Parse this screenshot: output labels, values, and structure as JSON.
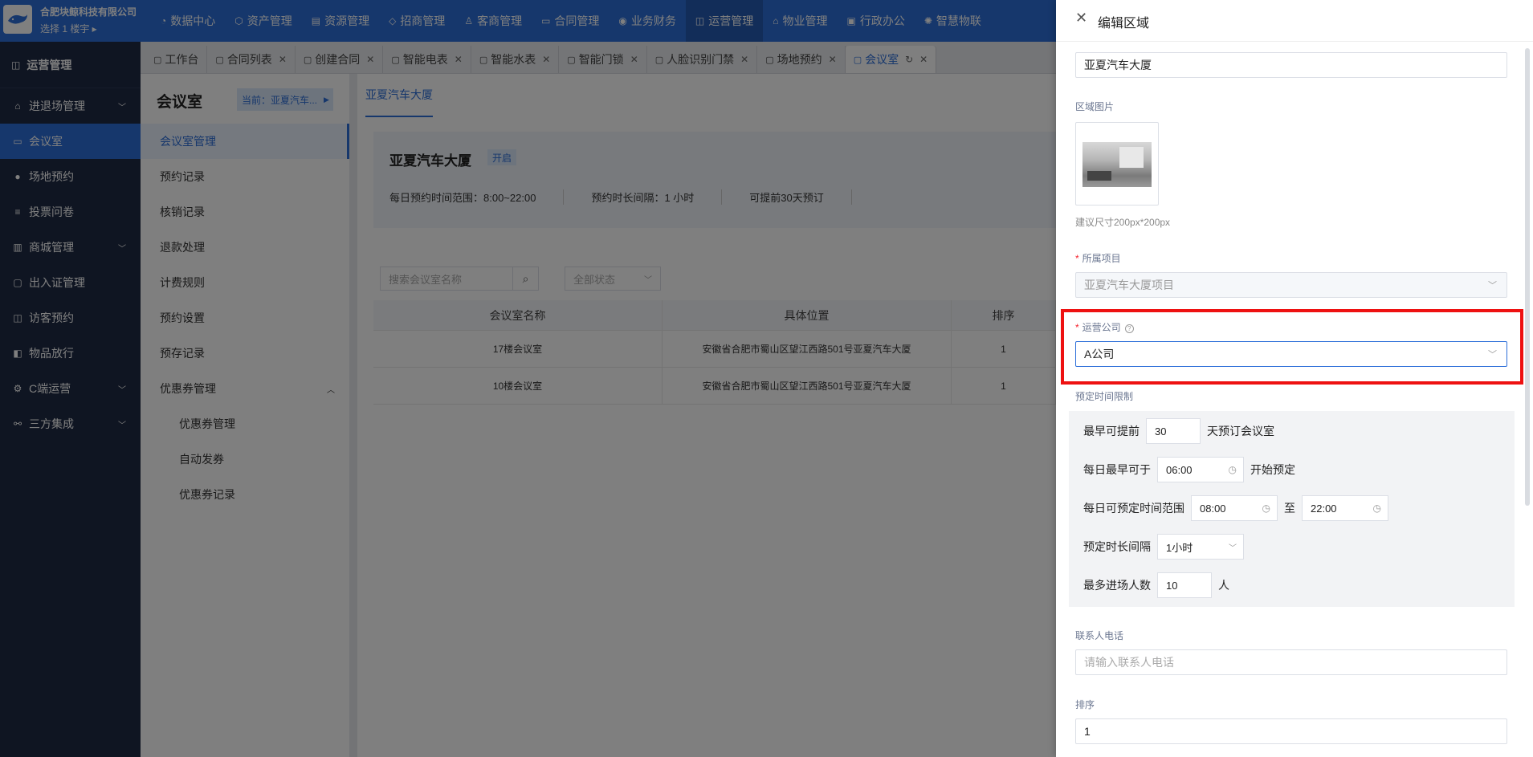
{
  "header": {
    "company": "合肥块鲸科技有限公司",
    "building_selector": "选择 1 楼宇 ▸",
    "nav": [
      {
        "icon": "dashboard-icon",
        "label": "数据中心"
      },
      {
        "icon": "asset-icon",
        "label": "资产管理"
      },
      {
        "icon": "resource-icon",
        "label": "资源管理"
      },
      {
        "icon": "tag-icon",
        "label": "招商管理"
      },
      {
        "icon": "customer-icon",
        "label": "客商管理"
      },
      {
        "icon": "contract-icon",
        "label": "合同管理"
      },
      {
        "icon": "finance-icon",
        "label": "业务财务"
      },
      {
        "icon": "operation-icon",
        "label": "运营管理"
      },
      {
        "icon": "property-icon",
        "label": "物业管理"
      },
      {
        "icon": "office-icon",
        "label": "行政办公"
      },
      {
        "icon": "smart-icon",
        "label": "智慧物联"
      }
    ]
  },
  "sidebar": {
    "heading": "运营管理",
    "items": [
      {
        "label": "进退场管理",
        "icon": "home-icon",
        "expandable": true
      },
      {
        "label": "会议室",
        "icon": "meeting-icon",
        "active": true
      },
      {
        "label": "场地预约",
        "icon": "user-icon"
      },
      {
        "label": "投票问卷",
        "icon": "survey-icon"
      },
      {
        "label": "商城管理",
        "icon": "shop-icon",
        "expandable": true
      },
      {
        "label": "出入证管理",
        "icon": "pass-icon"
      },
      {
        "label": "访客预约",
        "icon": "visitor-icon"
      },
      {
        "label": "物品放行",
        "icon": "item-icon"
      },
      {
        "label": "C端运营",
        "icon": "gear-icon",
        "expandable": true
      },
      {
        "label": "三方集成",
        "icon": "link-icon",
        "expandable": true
      }
    ]
  },
  "tabs": [
    {
      "label": "工作台",
      "closable": false
    },
    {
      "label": "合同列表",
      "closable": true
    },
    {
      "label": "创建合同",
      "closable": true
    },
    {
      "label": "智能电表",
      "closable": true
    },
    {
      "label": "智能水表",
      "closable": true
    },
    {
      "label": "智能门锁",
      "closable": true
    },
    {
      "label": "人脸识别门禁",
      "closable": true
    },
    {
      "label": "场地预约",
      "closable": true
    },
    {
      "label": "会议室",
      "closable": true,
      "active": true
    }
  ],
  "leftpane": {
    "title": "会议室",
    "current": "当前：亚夏汽车...",
    "menu": [
      {
        "label": "会议室管理",
        "active": true
      },
      {
        "label": "预约记录"
      },
      {
        "label": "核销记录"
      },
      {
        "label": "退款处理"
      },
      {
        "label": "计费规则"
      },
      {
        "label": "预约设置"
      },
      {
        "label": "预存记录"
      },
      {
        "label": "优惠券管理",
        "expanded": true
      },
      {
        "label": "优惠券管理",
        "sub": true
      },
      {
        "label": "自动发券",
        "sub": true
      },
      {
        "label": "优惠券记录",
        "sub": true
      }
    ]
  },
  "content": {
    "subtab": "亚夏汽车大厦",
    "card_title": "亚夏汽车大厦",
    "card_badge": "开启",
    "info": [
      "每日预约时间范围：8:00~22:00",
      "预约时长间隔：1 小时",
      "可提前30天预订"
    ],
    "search_placeholder": "搜索会议室名称",
    "status_filter": "全部状态",
    "table": {
      "headers": [
        "会议室名称",
        "具体位置",
        "排序"
      ],
      "rows": [
        [
          "17楼会议室",
          "安徽省合肥市蜀山区望江西路501号亚夏汽车大厦",
          "1"
        ],
        [
          "10楼会议室",
          "安徽省合肥市蜀山区望江西路501号亚夏汽车大厦",
          "1"
        ]
      ]
    }
  },
  "drawer": {
    "title": "编辑区域",
    "area_name": "亚夏汽车大厦",
    "image_label": "区域图片",
    "image_hint": "建议尺寸200px*200px",
    "project_label": "所属项目",
    "project_value": "亚夏汽车大厦项目",
    "company_label": "运营公司",
    "company_value": "A公司",
    "time_limit_label": "预定时间限制",
    "advance_prefix": "最早可提前",
    "advance_value": "30",
    "advance_suffix": "天预订会议室",
    "earliest_prefix": "每日最早可于",
    "earliest_value": "06:00",
    "earliest_suffix": "开始预定",
    "range_prefix": "每日可预定时间范围",
    "range_start": "08:00",
    "range_sep": "至",
    "range_end": "22:00",
    "interval_prefix": "预定时长间隔",
    "interval_value": "1小时",
    "max_people_prefix": "最多进场人数",
    "max_people_value": "10",
    "max_people_suffix": "人",
    "phone_label": "联系人电话",
    "phone_placeholder": "请输入联系人电话",
    "sort_label": "排序",
    "sort_value": "1"
  },
  "colors": {
    "primary": "#2d6fd9",
    "sidebar": "#1f2a44",
    "highlight": "#ee1111"
  }
}
